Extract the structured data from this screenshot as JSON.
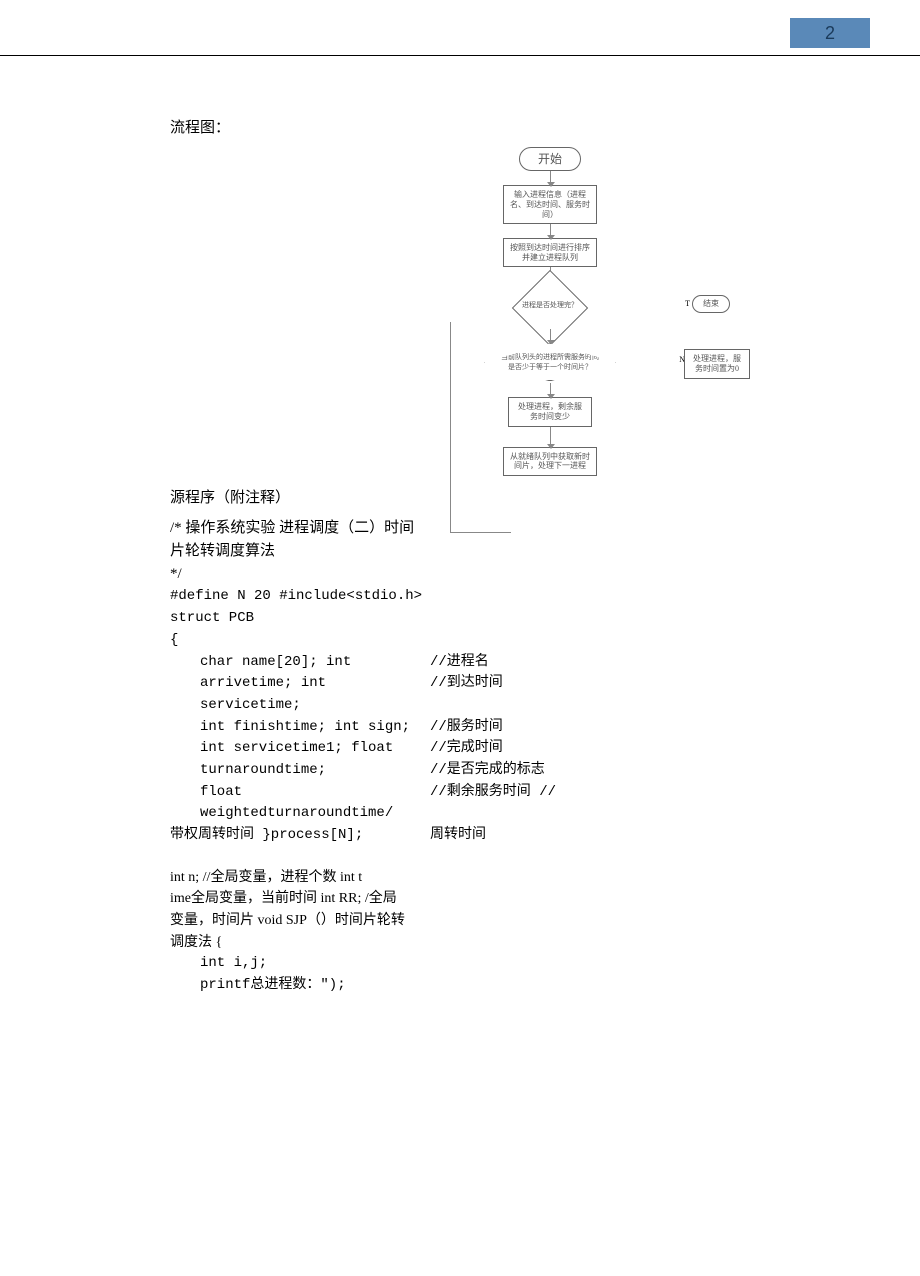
{
  "page_number": "2",
  "section_flowchart_title": "流程图：",
  "flowchart": {
    "start": "开始",
    "n1": "输入进程信息（进程名、到达时间、服务时间）",
    "n2": "按照到达时间进行排序并建立进程队列",
    "d1": "进程是否处理完？",
    "t": "T",
    "end": "结束",
    "d2": "当前队列头的进程所需服务时间是否少于等于一个时间片？",
    "n_right": "处理进程，服务时间置为0",
    "n3": "处理进程，剩余服务时间变少",
    "n4": "从就绪队列中获取新时间片，处理下一进程",
    "N": "N"
  },
  "section_source_title": "源程序（附注释）",
  "comment_l1": "/* 操作系统实验 进程调度（二）时间",
  "comment_l2": "片轮转调度算法",
  "comment_l3": "*/",
  "code_define": "#define N 20 #include<stdio.h>",
  "code_struct": "struct PCB",
  "code_brace_open": "{",
  "struct": [
    {
      "left": "char name[20]; int",
      "right": "//进程名"
    },
    {
      "left": "arrivetime; int servicetime;",
      "right": "//到达时间"
    },
    {
      "left": "int finishtime; int sign;",
      "right": "//服务时间"
    },
    {
      "left": "int servicetime1; float",
      "right": "//完成时间"
    },
    {
      "left": "turnaroundtime;",
      "right": "//是否完成的标志"
    },
    {
      "left": "float weightedturnaroundtime/",
      "right": "//剩余服务时间 //"
    }
  ],
  "code_close_l": "带权周转时间 }process[N];",
  "code_close_r": "周转时间",
  "para2_l1": "int n; //全局变量，进程个数 int t",
  "para2_l2": "ime全局变量，当前时间 int RR; /全局",
  "para2_l3": "变量，时间片 void SJP（）时间片轮转",
  "para2_l4": "调度法 {",
  "para2_l5": "int i,j;",
  "para2_l6": "printf总进程数：\");"
}
